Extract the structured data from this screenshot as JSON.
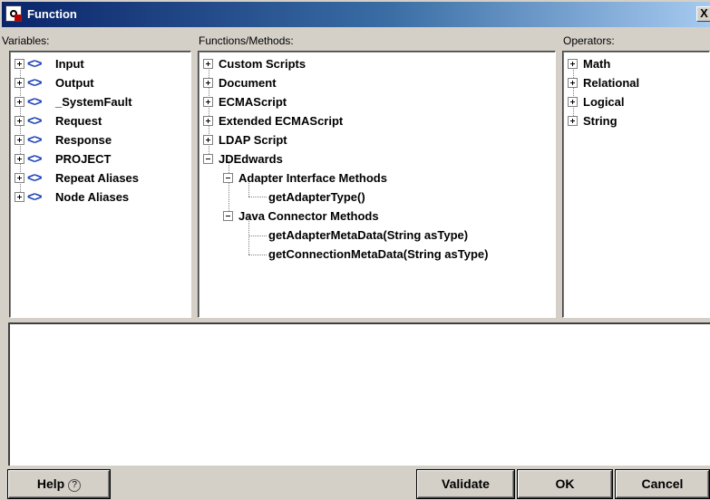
{
  "window": {
    "title": "Function",
    "close_glyph": "X"
  },
  "variables": {
    "label": "Variables:",
    "items": [
      {
        "label": "Input"
      },
      {
        "label": "Output"
      },
      {
        "label": "_SystemFault"
      },
      {
        "label": "Request"
      },
      {
        "label": "Response"
      },
      {
        "label": "PROJECT"
      },
      {
        "label": "Repeat Aliases"
      },
      {
        "label": "Node Aliases"
      }
    ],
    "glyph": "<>"
  },
  "functions": {
    "label": "Functions/Methods:",
    "items": [
      {
        "label": "Custom Scripts"
      },
      {
        "label": "Document"
      },
      {
        "label": "ECMAScript"
      },
      {
        "label": "Extended ECMAScript"
      },
      {
        "label": "LDAP Script"
      },
      {
        "label": "JDEdwards",
        "children": [
          {
            "label": "Adapter Interface Methods",
            "children": [
              {
                "label": "getAdapterType()"
              }
            ]
          },
          {
            "label": "Java Connector Methods",
            "children": [
              {
                "label": "getAdapterMetaData(String asType)"
              },
              {
                "label": "getConnectionMetaData(String asType)"
              }
            ]
          }
        ]
      }
    ]
  },
  "operators": {
    "label": "Operators:",
    "items": [
      {
        "label": "Math"
      },
      {
        "label": "Relational"
      },
      {
        "label": "Logical"
      },
      {
        "label": "String"
      }
    ]
  },
  "editor": {
    "value": ""
  },
  "buttons": {
    "help": "Help",
    "help_glyph": "?",
    "validate": "Validate",
    "ok": "OK",
    "cancel": "Cancel"
  }
}
